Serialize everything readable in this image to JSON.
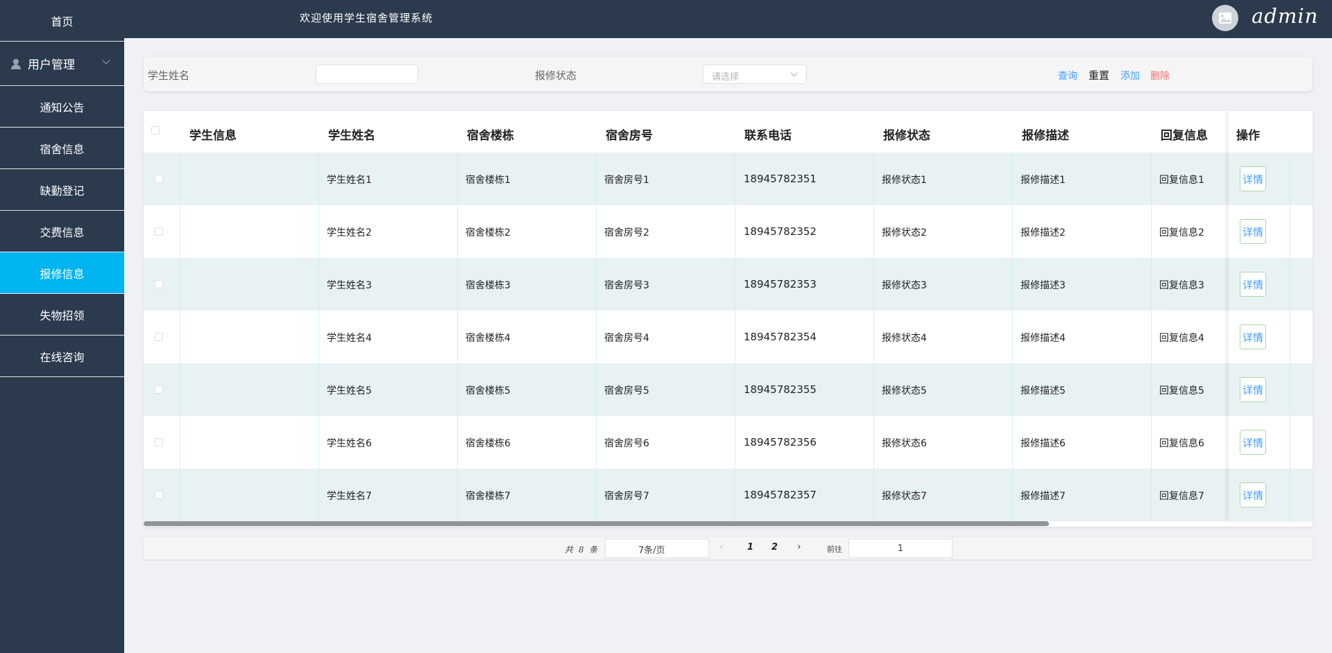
{
  "header": {
    "welcome": "欢迎使用学生宿舍管理系统",
    "username": "admin"
  },
  "sidebar": {
    "items": [
      {
        "label": "首页"
      },
      {
        "label": "用户管理"
      },
      {
        "label": "通知公告"
      },
      {
        "label": "宿舍信息"
      },
      {
        "label": "缺勤登记"
      },
      {
        "label": "交费信息"
      },
      {
        "label": "报修信息",
        "active": true
      },
      {
        "label": "失物招领"
      },
      {
        "label": "在线咨询"
      }
    ]
  },
  "search": {
    "name_label": "学生姓名",
    "name_value": "",
    "status_label": "报修状态",
    "status_placeholder": "请选择",
    "query": "查询",
    "reset": "重置",
    "add": "添加",
    "delete": "删除"
  },
  "table": {
    "headers": [
      "学生信息",
      "学生姓名",
      "宿舍楼栋",
      "宿舍房号",
      "联系电话",
      "报修状态",
      "报修描述",
      "回复信息",
      "操作"
    ],
    "detail_label": "详情",
    "rows": [
      {
        "info": "",
        "name": "学生姓名1",
        "building": "宿舍楼栋1",
        "room": "宿舍房号1",
        "phone": "18945782351",
        "status": "报修状态1",
        "desc": "报修描述1",
        "reply": "回复信息1"
      },
      {
        "info": "",
        "name": "学生姓名2",
        "building": "宿舍楼栋2",
        "room": "宿舍房号2",
        "phone": "18945782352",
        "status": "报修状态2",
        "desc": "报修描述2",
        "reply": "回复信息2"
      },
      {
        "info": "",
        "name": "学生姓名3",
        "building": "宿舍楼栋3",
        "room": "宿舍房号3",
        "phone": "18945782353",
        "status": "报修状态3",
        "desc": "报修描述3",
        "reply": "回复信息3"
      },
      {
        "info": "",
        "name": "学生姓名4",
        "building": "宿舍楼栋4",
        "room": "宿舍房号4",
        "phone": "18945782354",
        "status": "报修状态4",
        "desc": "报修描述4",
        "reply": "回复信息4"
      },
      {
        "info": "",
        "name": "学生姓名5",
        "building": "宿舍楼栋5",
        "room": "宿舍房号5",
        "phone": "18945782355",
        "status": "报修状态5",
        "desc": "报修描述5",
        "reply": "回复信息5"
      },
      {
        "info": "",
        "name": "学生姓名6",
        "building": "宿舍楼栋6",
        "room": "宿舍房号6",
        "phone": "18945782356",
        "status": "报修状态6",
        "desc": "报修描述6",
        "reply": "回复信息6"
      },
      {
        "info": "",
        "name": "学生姓名7",
        "building": "宿舍楼栋7",
        "room": "宿舍房号7",
        "phone": "18945782357",
        "status": "报修状态7",
        "desc": "报修描述7",
        "reply": "回复信息7"
      }
    ]
  },
  "pagination": {
    "total": "共 8 条",
    "page_size": "7条/页",
    "pages": [
      "1",
      "2"
    ],
    "goto_label": "前往",
    "goto_value": "1"
  },
  "colors": {
    "sidebar_bg": "#2b3a4d",
    "active_bg": "#00b4f0",
    "link_blue": "#409eff",
    "delete_red": "#f56c6c",
    "row_stripe": "#e8f2f2"
  }
}
